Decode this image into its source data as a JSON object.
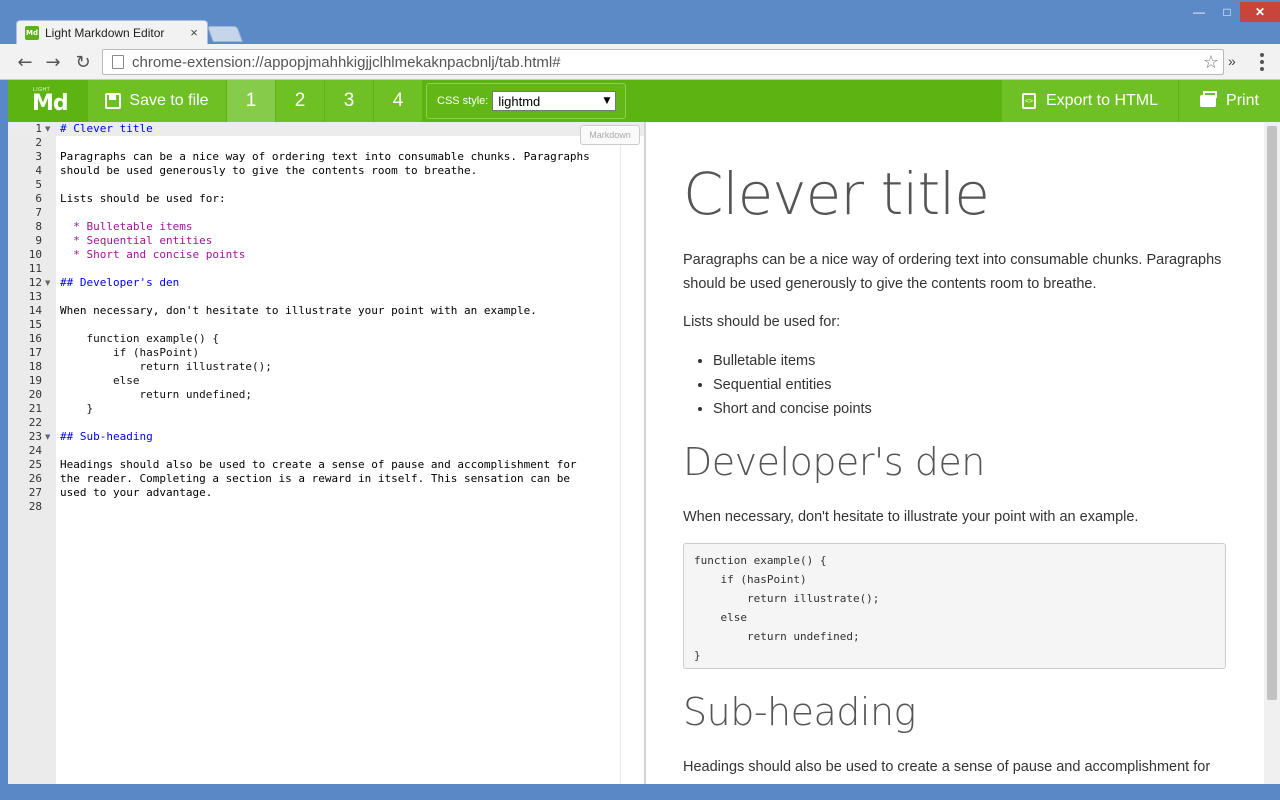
{
  "browser": {
    "tab_title": "Light Markdown Editor",
    "tab_icon_label": "Md",
    "tab_close": "×",
    "url": "chrome-extension://appopjmahhkigjjclhlmekaknpacbnlj/tab.html#",
    "ext_more": "»",
    "back": "←",
    "forward": "→",
    "reload": "↻",
    "star": "☆",
    "minimize": "—",
    "maximize": "□",
    "close": "✕"
  },
  "appbar": {
    "logo_small": "LIGHT",
    "logo_main": "Md",
    "save_label": "Save to file",
    "documents": [
      "1",
      "2",
      "3",
      "4"
    ],
    "active_document": "1",
    "css_style_label": "CSS style:",
    "css_style_value": "lightmd",
    "css_select_arrow": "▼",
    "export_label": "Export to HTML",
    "export_icon": "<>",
    "print_label": "Print",
    "accent_color": "#5db311"
  },
  "editor": {
    "mode_badge": "Markdown",
    "lines": [
      {
        "n": "1",
        "fold": "▼",
        "text": "# Clever title",
        "type": "h"
      },
      {
        "n": "2",
        "text": ""
      },
      {
        "n": "3",
        "text": "Paragraphs can be a nice way of ordering text into consumable chunks. Paragraphs"
      },
      {
        "n": "4",
        "text": "should be used generously to give the contents room to breathe."
      },
      {
        "n": "5",
        "text": ""
      },
      {
        "n": "6",
        "text": "Lists should be used for:"
      },
      {
        "n": "7",
        "text": ""
      },
      {
        "n": "8",
        "text": "  * Bulletable items",
        "type": "li"
      },
      {
        "n": "9",
        "text": "  * Sequential entities",
        "type": "li"
      },
      {
        "n": "10",
        "text": "  * Short and concise points",
        "type": "li"
      },
      {
        "n": "11",
        "text": ""
      },
      {
        "n": "12",
        "fold": "▼",
        "text": "## Developer's den",
        "type": "h"
      },
      {
        "n": "13",
        "text": ""
      },
      {
        "n": "14",
        "text": "When necessary, don't hesitate to illustrate your point with an example."
      },
      {
        "n": "15",
        "text": ""
      },
      {
        "n": "16",
        "text": "    function example() {",
        "type": "code"
      },
      {
        "n": "17",
        "text": "        if (hasPoint)",
        "type": "code"
      },
      {
        "n": "18",
        "text": "            return illustrate();",
        "type": "code"
      },
      {
        "n": "19",
        "text": "        else",
        "type": "code"
      },
      {
        "n": "20",
        "text": "            return undefined;",
        "type": "code"
      },
      {
        "n": "21",
        "text": "    }",
        "type": "code"
      },
      {
        "n": "22",
        "text": ""
      },
      {
        "n": "23",
        "fold": "▼",
        "text": "## Sub-heading",
        "type": "h"
      },
      {
        "n": "24",
        "text": ""
      },
      {
        "n": "25",
        "text": "Headings should also be used to create a sense of pause and accomplishment for"
      },
      {
        "n": "26",
        "text": "the reader. Completing a section is a reward in itself. This sensation can be"
      },
      {
        "n": "27",
        "text": "used to your advantage."
      },
      {
        "n": "28",
        "text": ""
      }
    ]
  },
  "preview": {
    "title": "Clever title",
    "para1": "Paragraphs can be a nice way of ordering text into consumable chunks. Paragraphs should be used generously to give the contents room to breathe.",
    "para2": "Lists should be used for:",
    "list": [
      "Bulletable items",
      "Sequential entities",
      "Short and concise points"
    ],
    "h2_a": "Developer's den",
    "para3": "When necessary, don't hesitate to illustrate your point with an example.",
    "code": "function example() {\n    if (hasPoint)\n        return illustrate();\n    else\n        return undefined;\n}",
    "h2_b": "Sub-heading",
    "para4": "Headings should also be used to create a sense of pause and accomplishment for"
  }
}
